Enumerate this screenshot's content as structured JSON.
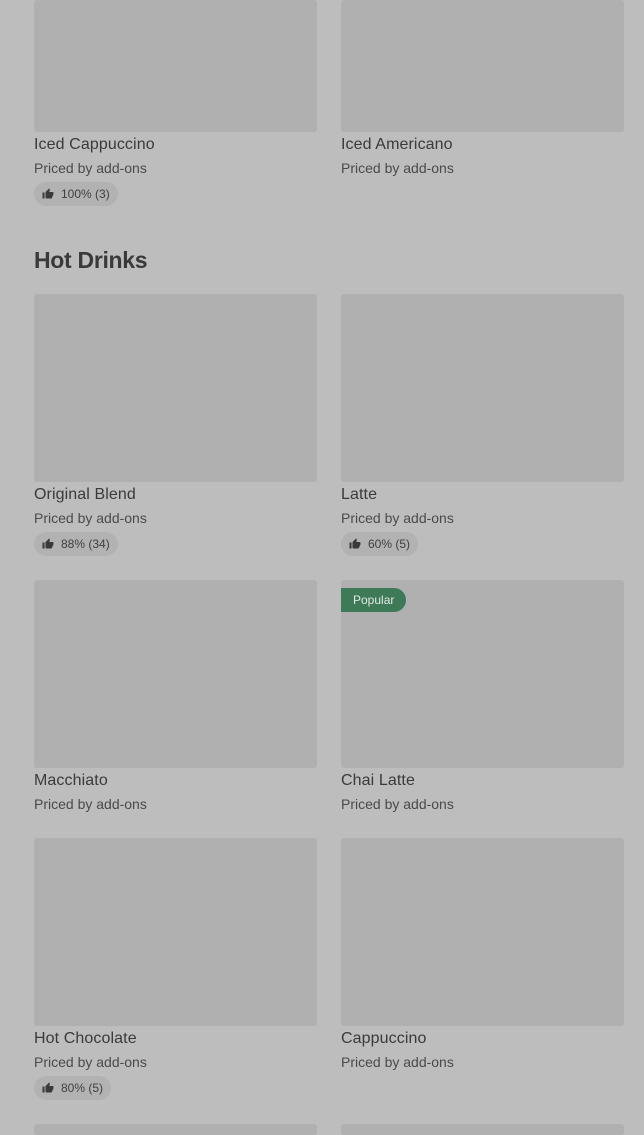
{
  "price_text": "Priced by add-ons",
  "sections": {
    "hot_drinks_title": "Hot Drinks"
  },
  "items": {
    "iced_cappuccino": {
      "name": "Iced Cappuccino",
      "rating": "100% (3)"
    },
    "iced_americano": {
      "name": "Iced Americano"
    },
    "original_blend": {
      "name": "Original Blend",
      "rating": "88% (34)"
    },
    "latte": {
      "name": "Latte",
      "rating": "60% (5)"
    },
    "macchiato": {
      "name": "Macchiato"
    },
    "chai_latte": {
      "name": "Chai Latte",
      "badge": "Popular"
    },
    "hot_chocolate": {
      "name": "Hot Chocolate",
      "rating": "80% (5)"
    },
    "cappuccino": {
      "name": "Cappuccino"
    }
  },
  "colors": {
    "background": "#bdbdbd",
    "image_placeholder": "#b0b0b0",
    "badge_green": "#3e7a57"
  },
  "icons": {
    "rating": "thumbs-up-icon"
  }
}
